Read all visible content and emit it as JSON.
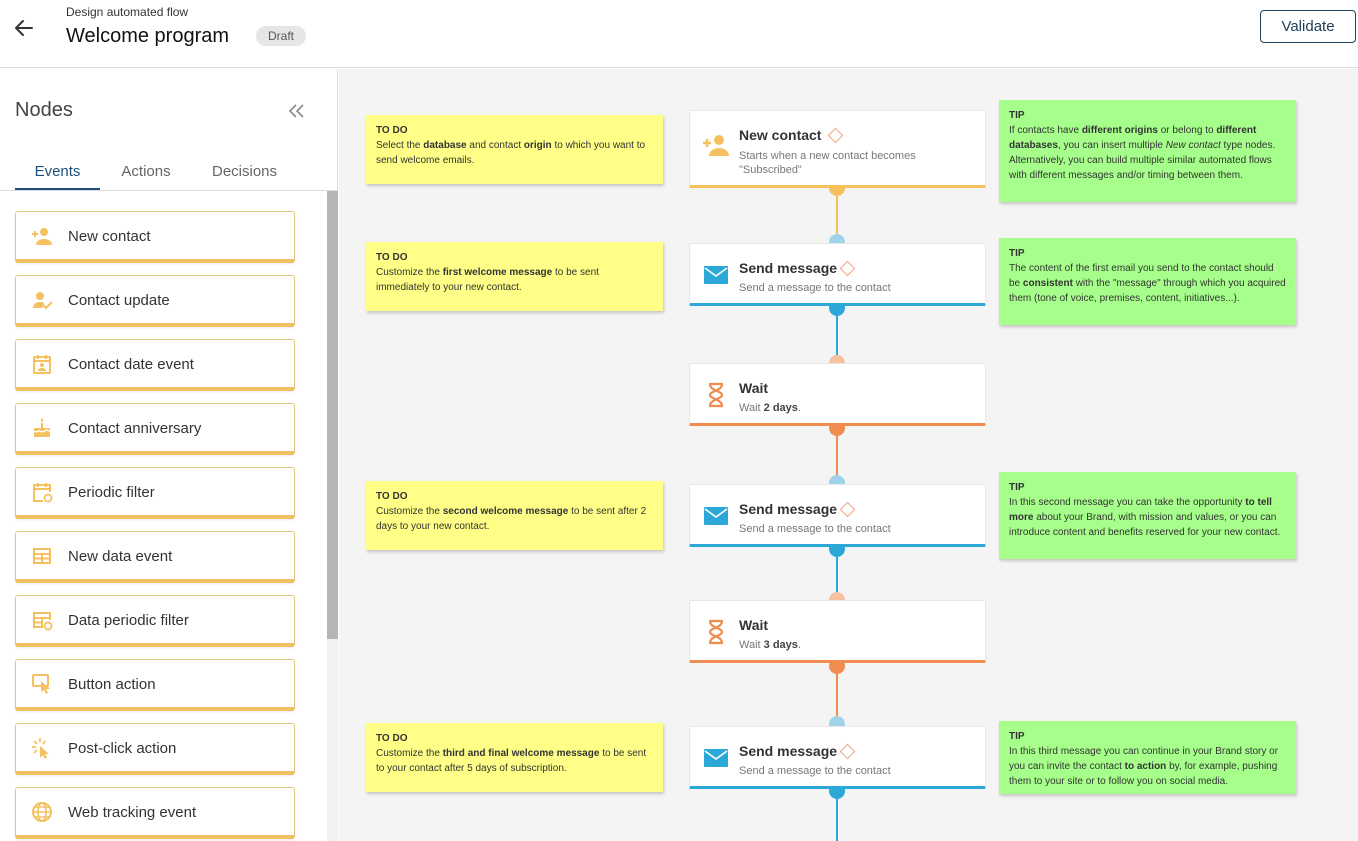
{
  "header": {
    "subtitle": "Design automated flow",
    "title": "Welcome program",
    "status_badge": "Draft",
    "validate_label": "Validate"
  },
  "sidebar": {
    "title": "Nodes",
    "tabs": [
      {
        "label": "Events",
        "active": true
      },
      {
        "label": "Actions",
        "active": false
      },
      {
        "label": "Decisions",
        "active": false
      }
    ],
    "events": [
      {
        "label": "New contact",
        "icon": "person-add-icon"
      },
      {
        "label": "Contact update",
        "icon": "person-check-icon"
      },
      {
        "label": "Contact date event",
        "icon": "calendar-contact-icon"
      },
      {
        "label": "Contact anniversary",
        "icon": "cake-icon"
      },
      {
        "label": "Periodic filter",
        "icon": "calendar-repeat-icon"
      },
      {
        "label": "New data event",
        "icon": "table-icon"
      },
      {
        "label": "Data periodic filter",
        "icon": "table-repeat-icon"
      },
      {
        "label": "Button action",
        "icon": "touch-icon"
      },
      {
        "label": "Post-click action",
        "icon": "click-icon"
      },
      {
        "label": "Web tracking event",
        "icon": "globe-icon"
      }
    ]
  },
  "flow": {
    "nodes": [
      {
        "title": "New contact",
        "description": "Starts when a new contact becomes \"Subscribed\"",
        "kind": "event"
      },
      {
        "title": "Send message",
        "description": "Send a message to the contact",
        "kind": "message"
      },
      {
        "title": "Wait",
        "description_prefix": "Wait ",
        "description_value": "2 days",
        "description_suffix": ".",
        "kind": "wait"
      },
      {
        "title": "Send message",
        "description": "Send a message to the contact",
        "kind": "message"
      },
      {
        "title": "Wait",
        "description_prefix": "Wait ",
        "description_value": "3 days",
        "description_suffix": ".",
        "kind": "wait"
      },
      {
        "title": "Send message",
        "description": "Send a message to the contact",
        "kind": "message"
      }
    ],
    "todo_notes": [
      {
        "heading": "TO DO",
        "parts": [
          "Select the ",
          "database",
          " and contact ",
          "origin",
          " to which you want to send welcome emails."
        ]
      },
      {
        "heading": "TO DO",
        "parts": [
          "Customize the ",
          "first welcome message",
          " to be sent immediately to your new contact."
        ]
      },
      {
        "heading": "TO DO",
        "parts": [
          "Customize the ",
          "second welcome message",
          " to be sent after 2 days to your new contact."
        ]
      },
      {
        "heading": "TO DO",
        "parts": [
          "Customize the ",
          "third and final welcome message",
          " to be sent to your contact after 5 days of subscription."
        ]
      }
    ],
    "tip_notes": [
      {
        "heading": "TIP",
        "parts": [
          "If contacts have ",
          "different origins",
          " or belong to ",
          "different databases",
          ", you can insert multiple ",
          "New contact",
          " type nodes. Alternatively, you can build multiple similar automated flows with different messages and/or timing between them."
        ]
      },
      {
        "heading": "TIP",
        "parts": [
          "The content of the first email you send to the contact should be ",
          "consistent",
          " with the \"message\" through which you acquired them (tone of voice, premises, content, initiatives...)."
        ]
      },
      {
        "heading": "TIP",
        "parts": [
          "In this second message you can take the opportunity ",
          "to tell more",
          " about your Brand, with mission and values, or you can introduce content and benefits reserved for your new contact."
        ]
      },
      {
        "heading": "TIP",
        "parts": [
          "In this third message you can continue in your Brand story or you can invite the contact ",
          "to action",
          " by, for example, pushing them to your site or to follow you on social media."
        ]
      }
    ]
  },
  "colors": {
    "event": "#f5c05e",
    "message": "#2ca8d8",
    "wait": "#ef8c4e",
    "todo_note": "#ffff88",
    "tip_note": "#a6ff8a"
  }
}
